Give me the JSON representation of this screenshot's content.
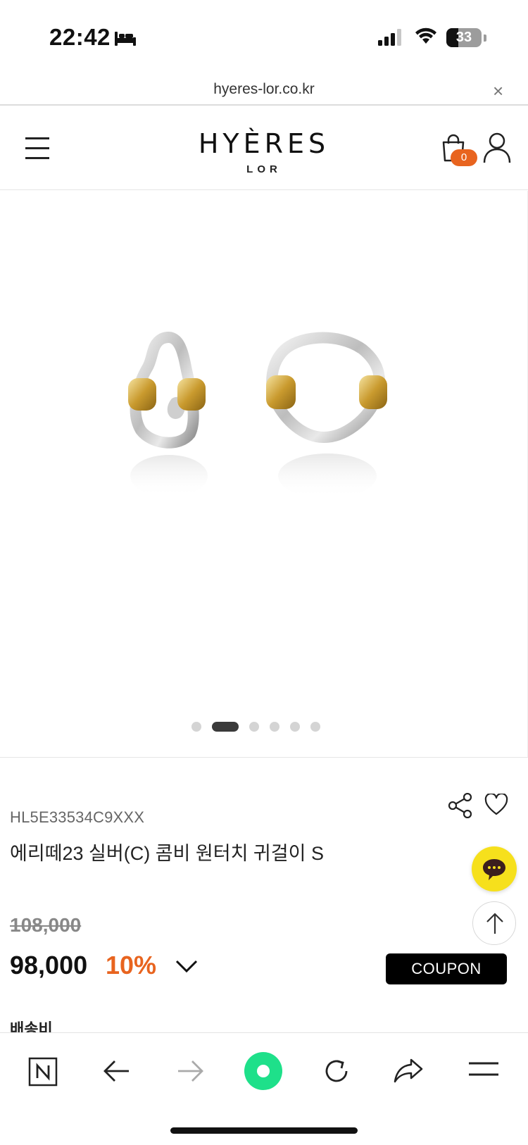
{
  "status_bar": {
    "time": "22:42",
    "battery": "33",
    "battery_level": 0.33
  },
  "url_bar": {
    "url": "hyeres-lor.co.kr",
    "close": "×"
  },
  "header": {
    "logo_main": "HYÈRES",
    "logo_sub": "LOR",
    "cart_count": "0"
  },
  "gallery": {
    "total_images": 6,
    "active_index": 1
  },
  "product": {
    "sku": "HL5E33534C9XXX",
    "name": "에리떼23 실버(C) 콤비 원터치 귀걸이 S",
    "original_price": "108,000",
    "sale_price": "98,000",
    "discount": "10%",
    "coupon_label": "COUPON",
    "shipping_label": "배송비"
  },
  "icons": {
    "menu": "menu-icon",
    "cart": "shopping-bag-icon",
    "user": "user-icon",
    "share": "share-icon",
    "wishlist": "heart-icon",
    "chat": "chat-icon",
    "top": "arrow-up-icon"
  },
  "colors": {
    "accent": "#e8641f",
    "chat_button": "#f6e01c",
    "browser_green": "#1ee08a"
  }
}
